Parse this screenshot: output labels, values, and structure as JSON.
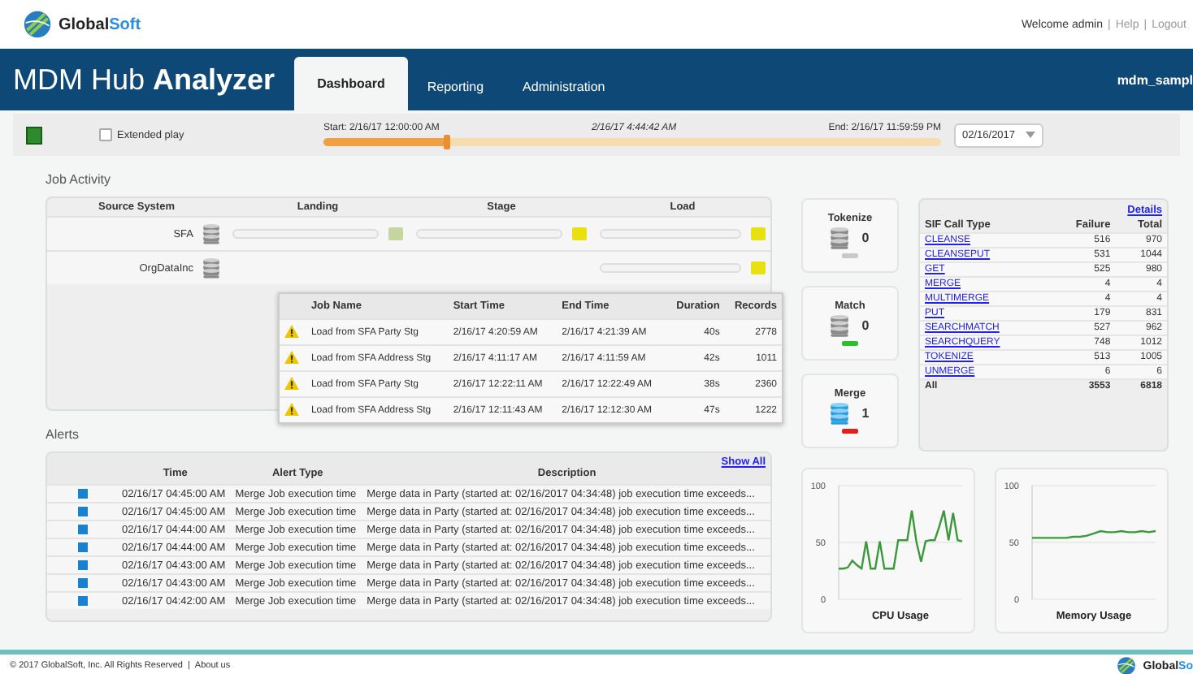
{
  "header": {
    "logo": {
      "name_start": "Global",
      "name_end": "Soft"
    },
    "links": [
      "Welcome admin",
      "Help",
      "Logout"
    ],
    "separator": "|"
  },
  "navbar": {
    "title": "MDM Hub **Analyzer**",
    "tabs": [
      {
        "label": "Dashboard",
        "selected": true
      },
      {
        "label": "Reporting",
        "selected": false
      },
      {
        "label": "Administration",
        "selected": false
      }
    ],
    "user": "mdm_sampl"
  },
  "toolbar": {
    "extended_play": {
      "label": "Extended play",
      "checked": false
    },
    "timeline": {
      "start": "Start: 2/16/17 12:00:00 AM",
      "current": "2/16/17 4:44:42 AM",
      "end": "End: 2/16/17 11:59:59 PM",
      "level": 0.2
    },
    "date": "02/16/2017"
  },
  "job_activity": {
    "title": "Job Activity",
    "columns": [
      "Source System",
      "Landing",
      "Stage",
      "Load"
    ],
    "rows": [
      {
        "source": "SFA",
        "landing": {
          "color": "#c5d6a0"
        },
        "stage": {
          "color": "#e8e010"
        },
        "load": {
          "color": "#e8e010"
        }
      },
      {
        "source": "OrgDataInc",
        "load": {
          "color": "#e8e010"
        }
      }
    ],
    "jobs": {
      "columns": [
        "Job Name",
        "Start Time",
        "End Time",
        "Duration",
        "Records"
      ],
      "rows": [
        [
          "Load from SFA Party Stg",
          "2/16/17 4:20:59 AM",
          "2/16/17 4:21:39 AM",
          "40s",
          "2778"
        ],
        [
          "Load from SFA Address Stg",
          "2/16/17 4:11:17 AM",
          "2/16/17 4:11:59 AM",
          "42s",
          "1011"
        ],
        [
          "Load from SFA Party Stg",
          "2/16/17 12:22:11 AM",
          "2/16/17 12:22:49 AM",
          "38s",
          "2360"
        ],
        [
          "Load from SFA Address Stg",
          "2/16/17 12:11:43 AM",
          "2/16/17 12:12:30 AM",
          "47s",
          "1222"
        ]
      ]
    }
  },
  "counters": [
    {
      "label": "Tokenize",
      "value": "0",
      "active": false,
      "color": "#c8c8c8"
    },
    {
      "label": "Match",
      "value": "0",
      "active": false,
      "color": "#2cc02c"
    },
    {
      "label": "Merge",
      "value": "1",
      "active": true,
      "color": "#e02020"
    }
  ],
  "sif": {
    "link": "Details",
    "columns": [
      "SIF Call Type",
      "Failure",
      "Total"
    ],
    "rows": [
      [
        "CLEANSE",
        "516",
        "970"
      ],
      [
        "CLEANSEPUT",
        "531",
        "1044"
      ],
      [
        "GET",
        "525",
        "980"
      ],
      [
        "MERGE",
        "4",
        "4"
      ],
      [
        "MULTIMERGE",
        "4",
        "4"
      ],
      [
        "PUT",
        "179",
        "831"
      ],
      [
        "SEARCHMATCH",
        "527",
        "962"
      ],
      [
        "SEARCHQUERY",
        "748",
        "1012"
      ],
      [
        "TOKENIZE",
        "513",
        "1005"
      ],
      [
        "UNMERGE",
        "6",
        "6"
      ]
    ],
    "total": [
      "All",
      "3553",
      "6818"
    ]
  },
  "alerts": {
    "title": "Alerts",
    "link": "Show All",
    "columns": [
      "Time",
      "Alert Type",
      "Description"
    ],
    "rows": [
      [
        "02/16/17 04:45:00 AM",
        "Merge Job execution time",
        "Merge data in Party (started at: 02/16/2017 04:34:48) job execution time exceeds..."
      ],
      [
        "02/16/17 04:45:00 AM",
        "Merge Job execution time",
        "Merge data in Party (started at: 02/16/2017 04:34:48) job execution time exceeds..."
      ],
      [
        "02/16/17 04:44:00 AM",
        "Merge Job execution time",
        "Merge data in Party (started at: 02/16/2017 04:34:48) job execution time exceeds..."
      ],
      [
        "02/16/17 04:44:00 AM",
        "Merge Job execution time",
        "Merge data in Party (started at: 02/16/2017 04:34:48) job execution time exceeds..."
      ],
      [
        "02/16/17 04:43:00 AM",
        "Merge Job execution time",
        "Merge data in Party (started at: 02/16/2017 04:34:48) job execution time exceeds..."
      ],
      [
        "02/16/17 04:43:00 AM",
        "Merge Job execution time",
        "Merge data in Party (started at: 02/16/2017 04:34:48) job execution time exceeds..."
      ],
      [
        "02/16/17 04:42:00 AM",
        "Merge Job execution time",
        "Merge data in Party (started at: 02/16/2017 04:34:48) job execution time exceeds..."
      ]
    ]
  },
  "charts": [
    {
      "chart_data": {
        "type": "line",
        "xlabel": "CPU Usage",
        "ylim": [
          0,
          100
        ],
        "yticks": [
          0,
          50,
          100
        ],
        "series": [
          {
            "color": "#3a9a3a",
            "values": [
              27,
              27,
              28,
              34,
              30,
              27,
              51,
              27,
              27,
              51,
              27,
              27,
              27,
              52,
              52,
              52,
              78,
              50,
              33,
              51,
              52,
              52,
              64,
              78,
              52,
              76,
              52,
              51
            ]
          }
        ]
      }
    },
    {
      "chart_data": {
        "type": "line",
        "xlabel": "Memory Usage",
        "ylim": [
          0,
          100
        ],
        "yticks": [
          0,
          50,
          100
        ],
        "series": [
          {
            "color": "#3a9a3a",
            "values": [
              54,
              54,
              54,
              54,
              54,
              54,
              55,
              55,
              56,
              58,
              60,
              59,
              59,
              60,
              59,
              59,
              60,
              59,
              60
            ]
          }
        ]
      }
    }
  ],
  "footer": {
    "copyright": "© 2017 GlobalSoft, Inc. All Rights Reserved",
    "separator": "|",
    "link": "About us",
    "logo": {
      "name_start": "Global",
      "name_end": "So"
    }
  }
}
